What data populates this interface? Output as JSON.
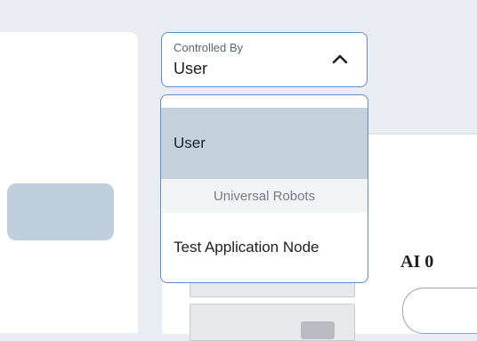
{
  "controlled_by": {
    "label": "Controlled By",
    "selected_value": "User",
    "options": [
      {
        "label": "User",
        "selected": true
      },
      {
        "group_label": "Universal Robots"
      },
      {
        "label": "Test Application Node",
        "selected": false
      }
    ],
    "chevron_icon": "chevron-up-icon"
  },
  "io_panel": {
    "ai_heading": "AI 0"
  },
  "colors": {
    "accent_border": "#5f8fc7",
    "selected_option_bg": "#c4d0dc",
    "page_bg": "#e9ecf0"
  }
}
